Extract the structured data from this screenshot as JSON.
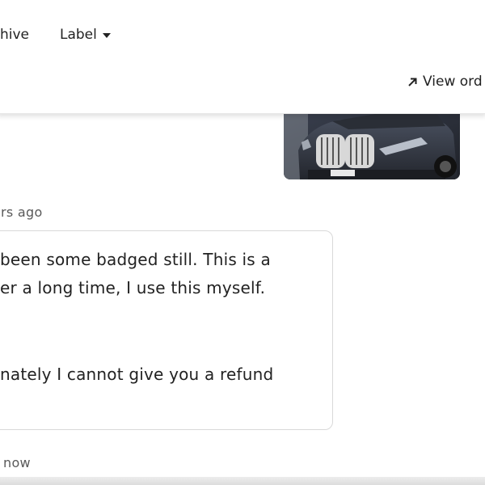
{
  "toolbar": {
    "archive_label": "hive",
    "label_menu": "Label",
    "view_order_label": "View ord"
  },
  "conversation": {
    "attachment": {
      "alt": "BMW SUV front grille photo"
    },
    "message": {
      "timestamp": "rs ago",
      "lines": [
        "been some badged still. This is a",
        "er a long time, I use this myself.",
        "nately I cannot give you a refund"
      ]
    },
    "reply_timestamp": "now"
  },
  "colors": {
    "text": "#222222",
    "muted": "#595959",
    "border": "#d9d9d9"
  }
}
